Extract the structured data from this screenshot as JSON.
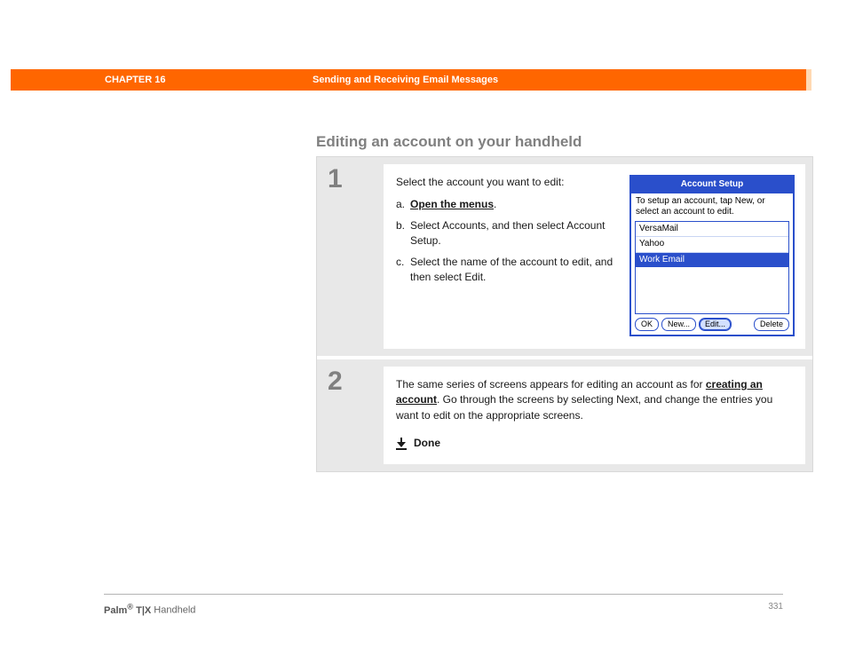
{
  "header": {
    "chapter": "CHAPTER 16",
    "title": "Sending and Receiving Email Messages"
  },
  "section_heading": "Editing an account on your handheld",
  "steps": [
    {
      "num": "1",
      "intro": "Select the account you want to edit:",
      "items": [
        {
          "letter": "a.",
          "link": "Open the menus",
          "suffix": "."
        },
        {
          "letter": "b.",
          "text": "Select Accounts, and then select Account Setup."
        },
        {
          "letter": "c.",
          "text": "Select the name of the account to edit, and then select Edit."
        }
      ],
      "screenshot": {
        "title": "Account Setup",
        "hint": "To setup an account, tap New, or select an account to edit.",
        "list": [
          {
            "label": "VersaMail",
            "selected": false
          },
          {
            "label": "Yahoo",
            "selected": false
          },
          {
            "label": "Work Email",
            "selected": true
          }
        ],
        "buttons": {
          "ok": "OK",
          "new": "New...",
          "edit": "Edit...",
          "delete": "Delete"
        }
      }
    },
    {
      "num": "2",
      "text_pre": "The same series of screens appears for editing an account as for ",
      "link": "creating an account",
      "text_post": ". Go through the screens by selecting Next, and change the entries you want to edit on the appropriate screens.",
      "done": "Done"
    }
  ],
  "footer": {
    "brand_bold": "Palm",
    "brand_sup": "®",
    "brand_model": " T|X",
    "brand_tail": " Handheld",
    "page": "331"
  }
}
